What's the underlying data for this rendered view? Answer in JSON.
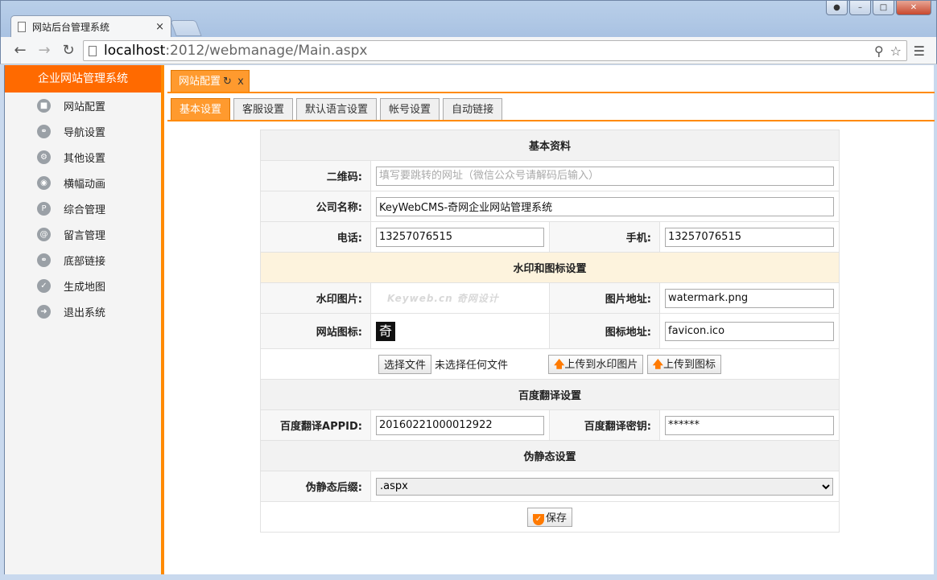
{
  "browser": {
    "tab_title": "网站后台管理系统",
    "tab_close": "×",
    "url_host": "localhost",
    "url_path": ":2012/webmanage/Main.aspx",
    "window_controls": [
      "minimize",
      "maximize",
      "close"
    ]
  },
  "sidebar": {
    "title": "企业网站管理系统",
    "items": [
      {
        "label": "网站配置",
        "icon": "settings-icon"
      },
      {
        "label": "导航设置",
        "icon": "link-icon"
      },
      {
        "label": "其他设置",
        "icon": "gear-icon"
      },
      {
        "label": "横幅动画",
        "icon": "camera-icon"
      },
      {
        "label": "综合管理",
        "icon": "p-icon"
      },
      {
        "label": "留言管理",
        "icon": "at-icon"
      },
      {
        "label": "底部链接",
        "icon": "link-icon"
      },
      {
        "label": "生成地图",
        "icon": "check-icon"
      },
      {
        "label": "退出系统",
        "icon": "arrow-right-icon"
      }
    ]
  },
  "page_tab": {
    "label": "网站配置",
    "refresh": "↻",
    "close": "x"
  },
  "sub_tabs": [
    "基本设置",
    "客服设置",
    "默认语言设置",
    "帐号设置",
    "自动链接"
  ],
  "form": {
    "section_basic": "基本资料",
    "qrcode_label": "二维码:",
    "qrcode_placeholder": "填写要跳转的网址（微信公众号请解码后输入）",
    "company_label": "公司名称:",
    "company_value": "KeyWebCMS-奇网企业网站管理系统",
    "phone_label": "电话:",
    "phone_value": "13257076515",
    "mobile_label": "手机:",
    "mobile_value": "13257076515",
    "section_watermark": "水印和图标设置",
    "watermark_label": "水印图片:",
    "watermark_image_text": "Keyweb.cn 奇网设计",
    "image_addr_label": "图片地址:",
    "image_addr_value": "watermark.png",
    "favicon_label": "网站图标:",
    "favicon_glyph": "奇",
    "icon_addr_label": "图标地址:",
    "icon_addr_value": "favicon.ico",
    "choose_file_button": "选择文件",
    "no_file_text": "未选择任何文件",
    "upload_watermark_button": "上传到水印图片",
    "upload_icon_button": "上传到图标",
    "section_baidu": "百度翻译设置",
    "appid_label": "百度翻译APPID:",
    "appid_value": "20160221000012922",
    "secret_label": "百度翻译密钥:",
    "secret_value": "******",
    "section_pseudo": "伪静态设置",
    "suffix_label": "伪静态后缀:",
    "suffix_value": ".aspx",
    "save_button": "保存"
  },
  "colors": {
    "accent": "#ff8a00",
    "sidebar_header": "#ff6a00",
    "tab_active": "#ff9a2e"
  }
}
